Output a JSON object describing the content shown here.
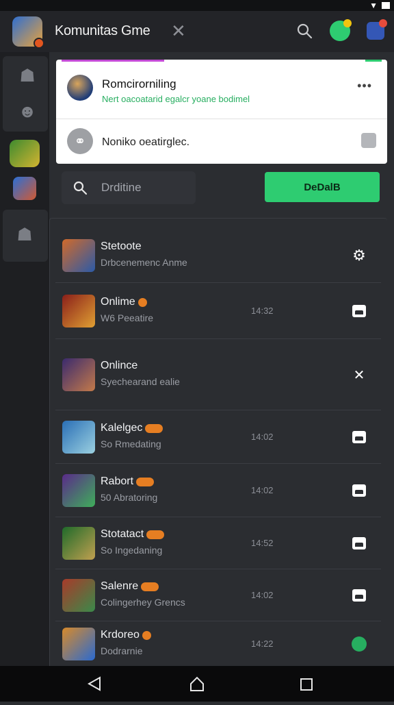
{
  "app": {
    "title": "Komunitas Gme"
  },
  "icons": {
    "close": "close-icon",
    "search": "search-icon",
    "messages": "chat-bubble-icon",
    "notifications": "notification-icon"
  },
  "popup": {
    "title": "Romcirorniling",
    "subtitle": "Nert oacoatarid egalcr yoane bodimel",
    "row_text": "Noniko oeatirglec."
  },
  "search": {
    "placeholder": "Drditine"
  },
  "action_button": {
    "label": "DeDalB"
  },
  "list": [
    {
      "name": "Stetoote",
      "status": "Drbcenemenc Anme",
      "time": "",
      "badge": "none",
      "action": "settings-icon"
    },
    {
      "name": "Onlime",
      "status": "W6 Peeatire",
      "time": "14:32",
      "badge": "single",
      "action": "image-icon"
    },
    {
      "name": "Onlince",
      "status": "Syechearand ealie",
      "time": "",
      "badge": "none",
      "action": "close-icon"
    },
    {
      "name": "Kalelgec",
      "status": "So Rmedating",
      "time": "14:02",
      "badge": "pair",
      "action": "image-icon"
    },
    {
      "name": "Rabort",
      "status": "50 Abratoring",
      "time": "14:02",
      "badge": "pair",
      "action": "image-icon"
    },
    {
      "name": "Stotatact",
      "status": "So Ingedaning",
      "time": "14:52",
      "badge": "pair",
      "action": "image-icon"
    },
    {
      "name": "Salenre",
      "status": "Colingerhey Grencs",
      "time": "14:02",
      "badge": "pair",
      "action": "image-icon"
    },
    {
      "name": "Krdoreo",
      "status": "Dodrarnie",
      "time": "14:22",
      "badge": "single",
      "action": "green-status-icon"
    }
  ],
  "colors": {
    "accent_green": "#2ecc71",
    "background": "#2b2d31",
    "sidebar": "#1e1f22"
  }
}
